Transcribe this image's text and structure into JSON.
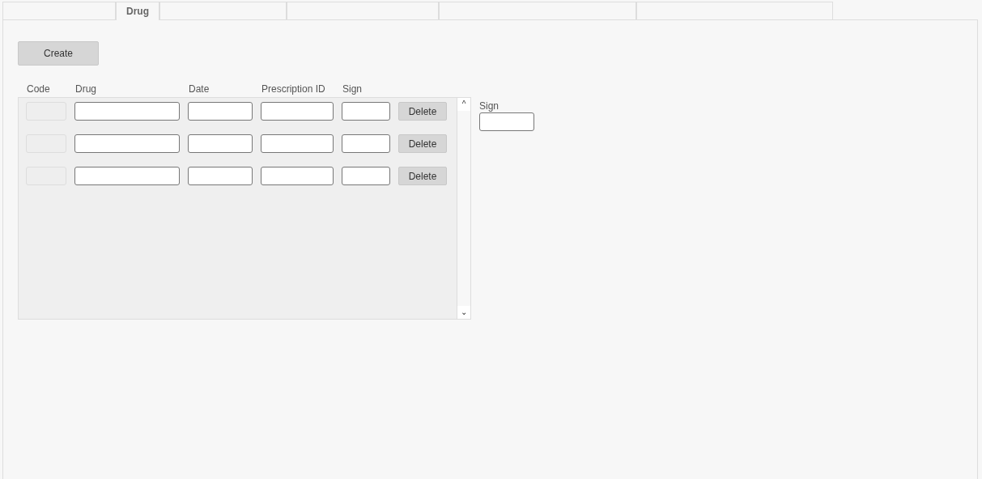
{
  "tabs": [
    {
      "selected": false
    },
    {
      "label": "Drug",
      "selected": true
    },
    {
      "selected": false
    },
    {
      "selected": false
    },
    {
      "selected": false
    },
    {
      "selected": false
    }
  ],
  "create_button": "Create",
  "table": {
    "columns": [
      "Code",
      "Drug",
      "Date",
      "Prescription ID",
      "Sign"
    ],
    "rows": [
      {
        "code_disabled": true,
        "delete_button": "Delete"
      },
      {
        "code_disabled": true,
        "delete_button": "Delete"
      },
      {
        "code_disabled": true,
        "delete_button": "Delete"
      }
    ],
    "scroll_up": "^",
    "scroll_down": "⌄"
  },
  "side_field": {
    "label": "Sign"
  }
}
